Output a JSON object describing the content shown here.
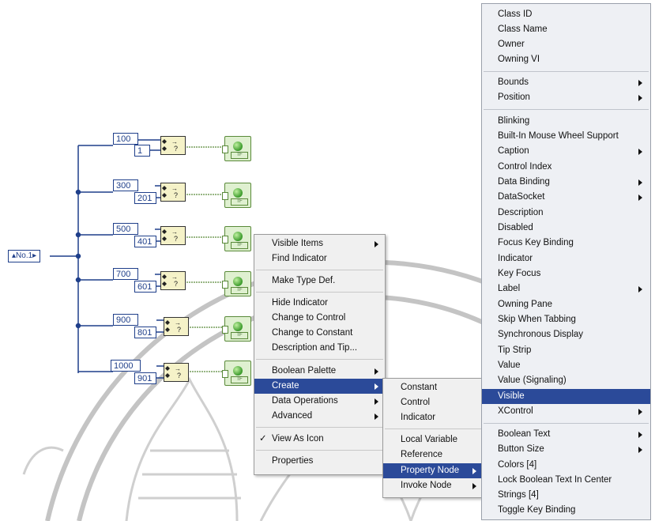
{
  "enum_control": {
    "label": "No.1"
  },
  "cases": [
    {
      "lo": "100",
      "hi": "1"
    },
    {
      "lo": "300",
      "hi": "201"
    },
    {
      "lo": "500",
      "hi": "401"
    },
    {
      "lo": "700",
      "hi": "601"
    },
    {
      "lo": "900",
      "hi": "801"
    },
    {
      "lo": "1000",
      "hi": "901"
    }
  ],
  "indicator_tf": "TF",
  "shortcut_menu": {
    "items": [
      {
        "label": "Visible Items",
        "submenu": true
      },
      {
        "label": "Find Indicator"
      },
      {
        "label": "Make Type Def."
      },
      {
        "label": "Hide Indicator"
      },
      {
        "label": "Change to Control"
      },
      {
        "label": "Change to Constant"
      },
      {
        "label": "Description and Tip..."
      },
      {
        "label": "Boolean Palette",
        "submenu": true
      },
      {
        "label": "Create",
        "submenu": true,
        "highlighted": true
      },
      {
        "label": "Data Operations",
        "submenu": true
      },
      {
        "label": "Advanced",
        "submenu": true
      },
      {
        "label": "View As Icon",
        "checked": true
      },
      {
        "label": "Properties"
      }
    ],
    "check_glyph": "✓"
  },
  "create_menu": {
    "items": [
      {
        "label": "Constant"
      },
      {
        "label": "Control"
      },
      {
        "label": "Indicator"
      },
      {
        "label": "Local Variable"
      },
      {
        "label": "Reference"
      },
      {
        "label": "Property Node",
        "submenu": true,
        "highlighted": true
      },
      {
        "label": "Invoke Node",
        "submenu": true
      }
    ]
  },
  "property_menu": {
    "items": [
      {
        "label": "Class ID"
      },
      {
        "label": "Class Name"
      },
      {
        "label": "Owner"
      },
      {
        "label": "Owning VI"
      },
      {
        "label": "Bounds",
        "submenu": true
      },
      {
        "label": "Position",
        "submenu": true
      },
      {
        "label": "Blinking"
      },
      {
        "label": "Built-In Mouse Wheel Support"
      },
      {
        "label": "Caption",
        "submenu": true
      },
      {
        "label": "Control Index"
      },
      {
        "label": "Data Binding",
        "submenu": true
      },
      {
        "label": "DataSocket",
        "submenu": true
      },
      {
        "label": "Description"
      },
      {
        "label": "Disabled"
      },
      {
        "label": "Focus Key Binding"
      },
      {
        "label": "Indicator"
      },
      {
        "label": "Key Focus"
      },
      {
        "label": "Label",
        "submenu": true
      },
      {
        "label": "Owning Pane"
      },
      {
        "label": "Skip When Tabbing"
      },
      {
        "label": "Synchronous Display"
      },
      {
        "label": "Tip Strip"
      },
      {
        "label": "Value"
      },
      {
        "label": "Value (Signaling)"
      },
      {
        "label": "Visible",
        "highlighted": true
      },
      {
        "label": "XControl",
        "submenu": true
      },
      {
        "label": "Boolean Text",
        "submenu": true
      },
      {
        "label": "Button Size",
        "submenu": true
      },
      {
        "label": "Colors [4]"
      },
      {
        "label": "Lock Boolean Text In Center"
      },
      {
        "label": "Strings [4]"
      },
      {
        "label": "Toggle Key Binding"
      }
    ]
  },
  "colors": {
    "wire_blue": "#1f3f8a",
    "wire_green": "#5a8a3a",
    "menu_highlight": "#2b4a99",
    "watermark": "#b8b8b8"
  }
}
